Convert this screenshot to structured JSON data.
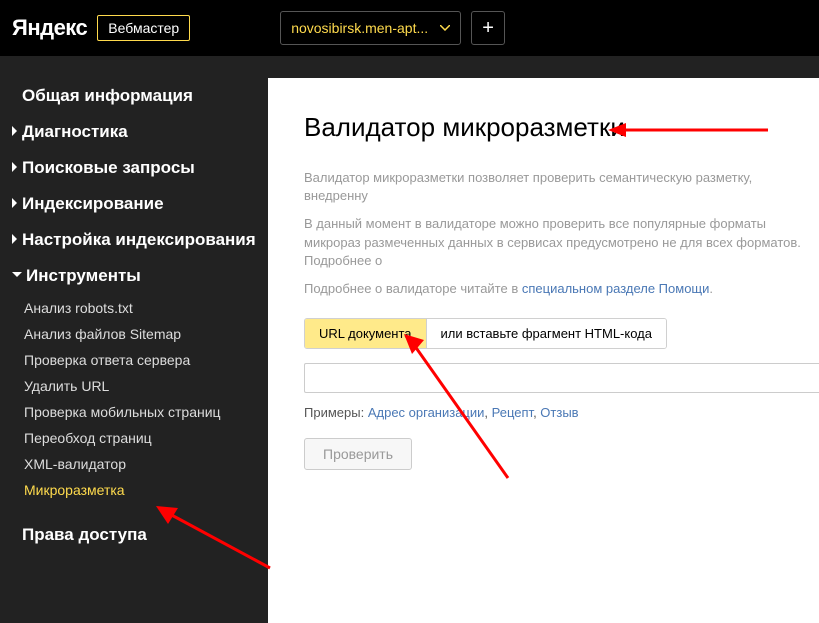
{
  "header": {
    "logo": "Яндекс",
    "product": "Вебмастер",
    "site_selector": "novosibirsk.men-apt...",
    "plus": "+"
  },
  "sidebar": {
    "items": [
      {
        "label": "Общая информация",
        "expandable": false
      },
      {
        "label": "Диагностика",
        "expandable": true
      },
      {
        "label": "Поисковые запросы",
        "expandable": true
      },
      {
        "label": "Индексирование",
        "expandable": true
      },
      {
        "label": "Настройка индексирования",
        "expandable": true
      },
      {
        "label": "Инструменты",
        "expandable": true,
        "expanded": true
      },
      {
        "label": "Права доступа",
        "expandable": false
      }
    ],
    "tools_sub": [
      {
        "label": "Анализ robots.txt"
      },
      {
        "label": "Анализ файлов Sitemap"
      },
      {
        "label": "Проверка ответа сервера"
      },
      {
        "label": "Удалить URL"
      },
      {
        "label": "Проверка мобильных страниц"
      },
      {
        "label": "Переобход страниц"
      },
      {
        "label": "XML-валидатор"
      },
      {
        "label": "Микроразметка",
        "active": true
      }
    ]
  },
  "main": {
    "title": "Валидатор микроразметки",
    "desc1": "Валидатор микроразметки позволяет проверить семантическую разметку, внедренну",
    "desc2": "В данный момент в валидаторе можно проверить все популярные форматы микрораз размеченных данных в сервисах предусмотрено не для всех форматов. Подробнее о",
    "desc3_pre": "Подробнее о валидаторе читайте в ",
    "desc3_link": "специальном разделе Помощи",
    "tabs": {
      "url": "URL документа",
      "code": "или вставьте фрагмент HTML-кода"
    },
    "examples_label": "Примеры:",
    "examples": {
      "e1": "Адрес организации",
      "e2": "Рецепт",
      "e3": "Отзыв"
    },
    "check_btn": "Проверить"
  }
}
